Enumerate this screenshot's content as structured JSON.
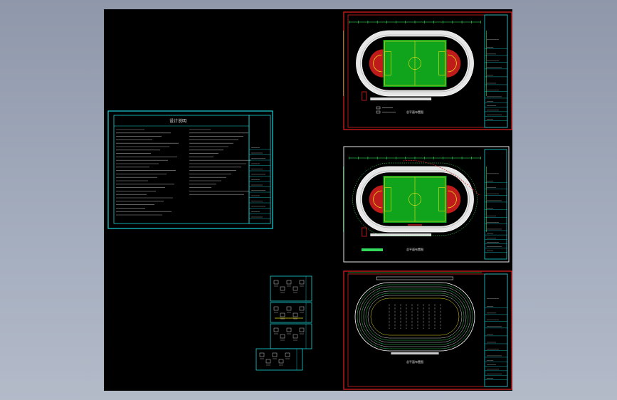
{
  "window": {
    "background": "#9aa3b5",
    "canvas_color": "#000000"
  },
  "colors": {
    "sheet_border_red": "#d42020",
    "sheet_border_white": "#ffffff",
    "frame_cyan": "#19d3d8",
    "pitch_green": "#10a31c",
    "field_line_yellow": "#e8e020",
    "track_white": "#e6e6e6",
    "dimension_green": "#3cff6a",
    "goal_red": "#e02020",
    "note_text_white": "#cfcfcf"
  },
  "sheets": {
    "notes_sheet": {
      "title": "设计说明"
    },
    "plan_1": {
      "caption": "总平面布置图"
    },
    "plan_2": {
      "caption": "总平面布置图",
      "legend_text": ""
    },
    "plan_3": {
      "caption": "总平面布置图"
    }
  },
  "icons": [
    "cad-sheet-icon",
    "drawing-stack-icon"
  ]
}
